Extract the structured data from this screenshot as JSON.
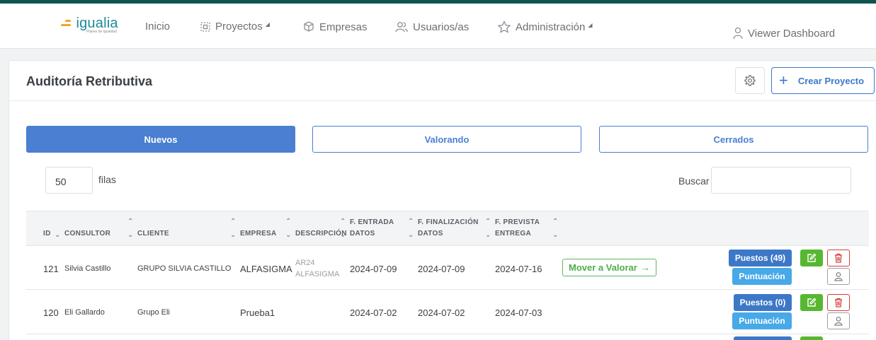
{
  "brand": {
    "name": "igualia",
    "tagline": "Planes de Igualdad"
  },
  "nav": {
    "items": [
      {
        "label": "Inicio",
        "icon": ""
      },
      {
        "label": "Proyectos",
        "icon": "dashed-square-icon"
      },
      {
        "label": "Empresas",
        "icon": "box-icon"
      },
      {
        "label": "Usuarios/as",
        "icon": "users-icon"
      },
      {
        "label": "Administración",
        "icon": "star-icon"
      }
    ],
    "user": "Viewer Dashboard"
  },
  "page": {
    "title": "Auditoría Retributiva",
    "create_label": "Crear Proyecto"
  },
  "tabs": [
    {
      "label": "Nuevos",
      "active": true
    },
    {
      "label": "Valorando",
      "active": false
    },
    {
      "label": "Cerrados",
      "active": false
    }
  ],
  "table_controls": {
    "rows_value": "50",
    "rows_label": "filas",
    "search_label": "Buscar"
  },
  "table": {
    "headers": {
      "id": "ID",
      "consultor": "CONSULTOR",
      "cliente": "CLIENTE",
      "empresa": "EMPRESA",
      "descripcion": "DESCRIPCIÓN",
      "f_entrada_1": "F. ENTRADA",
      "f_entrada_2": "DATOS",
      "f_final_1": "F. FINALIZACIÓN",
      "f_final_2": "DATOS",
      "f_prev_1": "F. PREVISTA",
      "f_prev_2": "ENTREGA"
    },
    "rows": [
      {
        "id": "121",
        "consultor": "Silvia Castillo",
        "cliente": "GRUPO SILVIA CASTILLO",
        "empresa": "ALFASIGMA",
        "desc_1": "AR24",
        "desc_2": "ALFASIGMA",
        "f_entrada": "2024-07-09",
        "f_final": "2024-07-09",
        "f_prev": "2024-07-16",
        "move_label": "Mover a Valorar",
        "puestos": "Puestos (49)",
        "puntuacion": "Puntuación"
      },
      {
        "id": "120",
        "consultor": "Eli Gallardo",
        "cliente": "Grupo Eli",
        "empresa": "Prueba1",
        "desc_1": "",
        "desc_2": "",
        "f_entrada": "2024-07-02",
        "f_final": "2024-07-02",
        "f_prev": "2024-07-03",
        "move_label": "",
        "puestos": "Puestos (0)",
        "puntuacion": "Puntuación"
      }
    ]
  },
  "colors": {
    "accent": "#4a7fd1",
    "topbar": "#0f5350",
    "success": "#58b731",
    "danger": "#d43f3a",
    "info": "#47a9e8"
  }
}
